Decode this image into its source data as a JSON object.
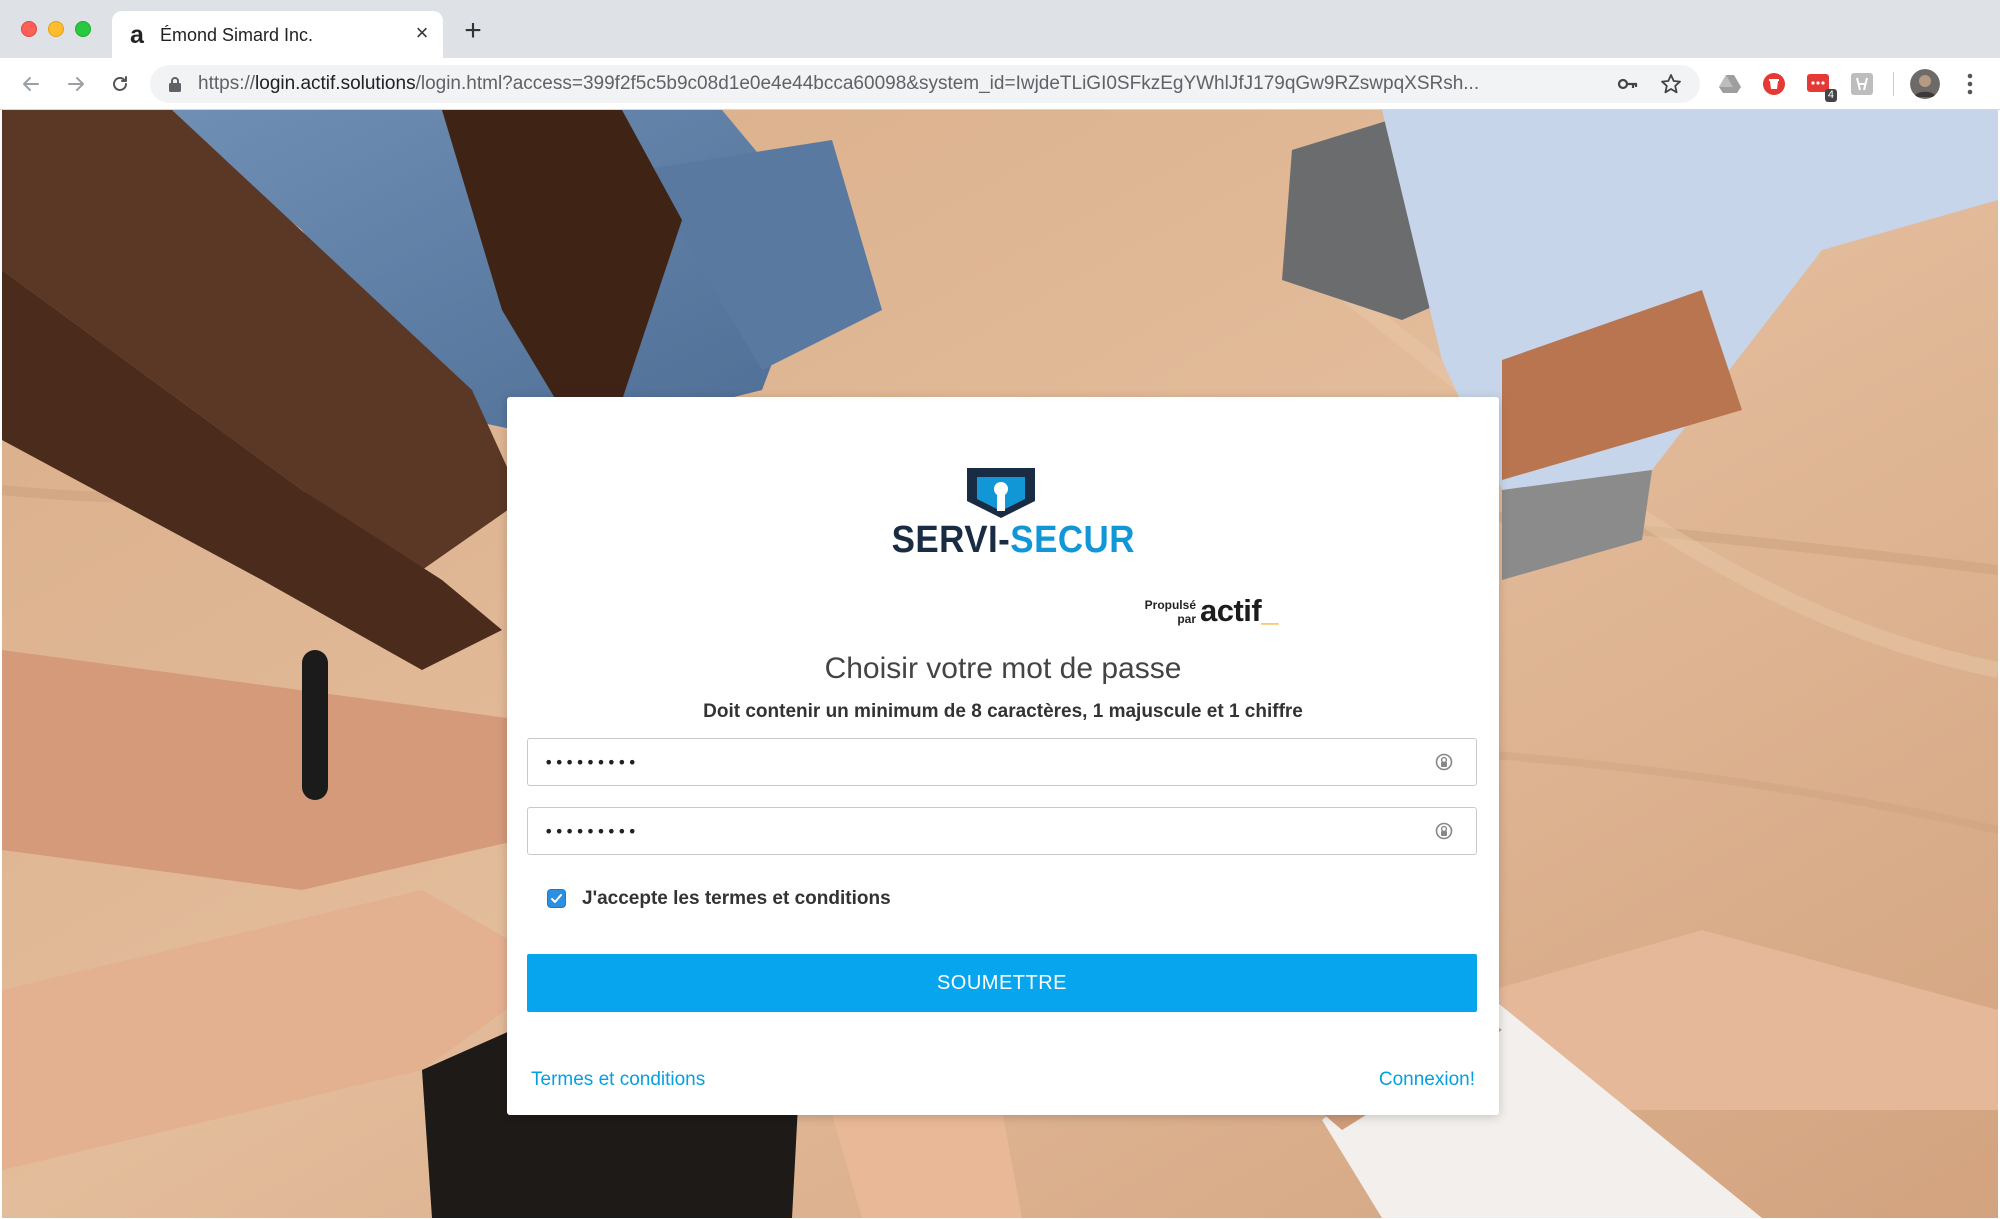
{
  "browser": {
    "tab": {
      "favicon": "a",
      "title": "Émond Simard Inc.",
      "close": "×"
    },
    "new_tab": "+",
    "url": {
      "scheme": "https://",
      "host": "login.actif.solutions",
      "path": "/login.html?access=399f2f5c5b9c08d1e0e4e44bcca60098&system_id=IwjdeTLiGI0SFkzEgYWhlJfJ179qGw9RZswpqXSRsh..."
    },
    "extensions": [
      "drive-icon",
      "shield-ext-icon",
      "chat-ext-icon",
      "translate-ext-icon",
      "profile-avatar"
    ],
    "badge": "4"
  },
  "login": {
    "brand_part1": "SERVI-",
    "brand_part2": "SECUR",
    "powered_line1": "Propulsé",
    "powered_line2": "par",
    "powered_brand": "actif",
    "powered_underscore": "_",
    "heading": "Choisir votre mot de passe",
    "subheading": "Doit contenir un minimum de 8 caractères, 1 majuscule et 1 chiffre",
    "password1_value": "•••••••••",
    "password2_value": "•••••••••",
    "accept_terms_label": "J'accepte les termes et conditions",
    "accept_terms_checked": true,
    "submit_label": "SOUMETTRE",
    "terms_link": "Termes et conditions",
    "login_link": "Connexion!"
  },
  "colors": {
    "accent": "#06a5ee",
    "link": "#079fe0",
    "brand_dark": "#1a2b44",
    "brand_blue": "#1197d6",
    "powered_accent": "#f4a81d"
  }
}
